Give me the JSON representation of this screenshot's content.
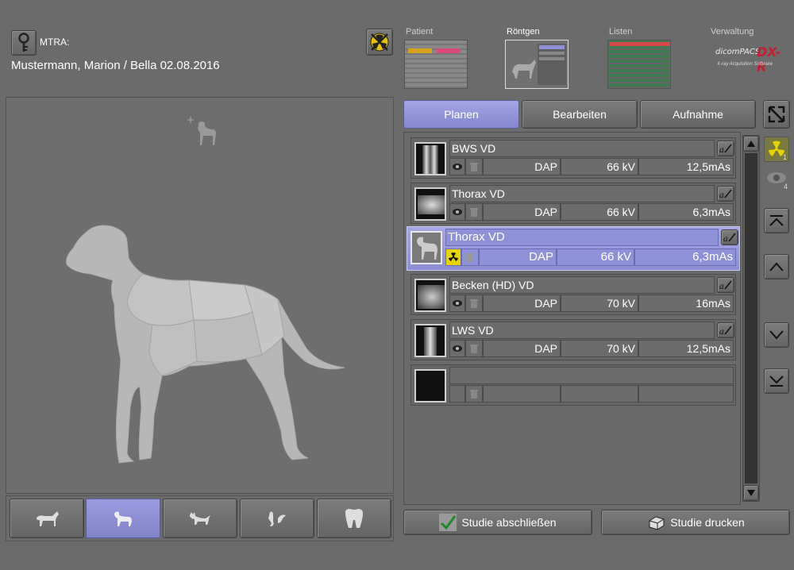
{
  "header": {
    "mtra_label": "MTRA:",
    "patient_line": "Mustermann, Marion / Bella  02.08.2016"
  },
  "modules": {
    "patient": "Patient",
    "roentgen": "Röntgen",
    "listen": "Listen",
    "verwaltung": "Verwaltung"
  },
  "logo": {
    "brand": "dicomPACS",
    "product": "DX-R",
    "subtitle": "X-ray Acquisition Software"
  },
  "tabs": {
    "planen": "Planen",
    "bearbeiten": "Bearbeiten",
    "aufnahme": "Aufnahme"
  },
  "exams": [
    {
      "name": "BWS VD",
      "dap": "DAP",
      "kv": "66 kV",
      "mas": "12,5mAs"
    },
    {
      "name": "Thorax VD",
      "dap": "DAP",
      "kv": "66 kV",
      "mas": "6,3mAs"
    },
    {
      "name": "Thorax VD",
      "dap": "DAP",
      "kv": "66 kV",
      "mas": "6,3mAs"
    },
    {
      "name": "Becken (HD) VD",
      "dap": "DAP",
      "kv": "70 kV",
      "mas": "16mAs"
    },
    {
      "name": "LWS VD",
      "dap": "DAP",
      "kv": "70 kV",
      "mas": "12,5mAs"
    },
    {
      "name": "",
      "dap": "",
      "kv": "",
      "mas": ""
    }
  ],
  "side_counts": {
    "radiation": "1",
    "viewed": "4"
  },
  "footer": {
    "finish": "Studie abschließen",
    "print": "Studie drucken"
  },
  "colors": {
    "accent": "#8c8ed6",
    "background": "#6b6b6b",
    "radiation": "#e8d400"
  }
}
